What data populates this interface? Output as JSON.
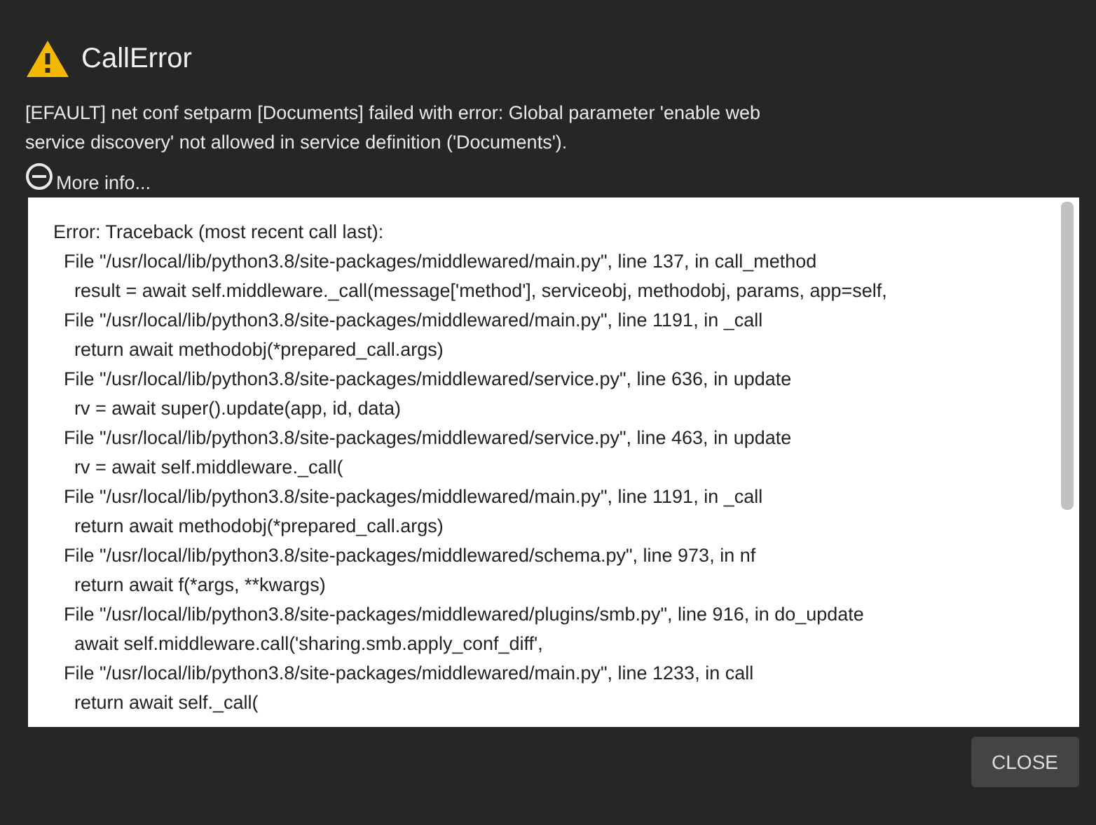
{
  "dialog": {
    "title": "CallError",
    "message": "[EFAULT] net conf setparm [Documents] failed with error: Global parameter 'enable web service discovery' not allowed in service definition ('Documents').",
    "more_info": {
      "label": "More info...",
      "expanded": true
    },
    "traceback": [
      "Error: Traceback (most recent call last):",
      "  File \"/usr/local/lib/python3.8/site-packages/middlewared/main.py\", line 137, in call_method",
      "    result = await self.middleware._call(message['method'], serviceobj, methodobj, params, app=self,",
      "  File \"/usr/local/lib/python3.8/site-packages/middlewared/main.py\", line 1191, in _call",
      "    return await methodobj(*prepared_call.args)",
      "  File \"/usr/local/lib/python3.8/site-packages/middlewared/service.py\", line 636, in update",
      "    rv = await super().update(app, id, data)",
      "  File \"/usr/local/lib/python3.8/site-packages/middlewared/service.py\", line 463, in update",
      "    rv = await self.middleware._call(",
      "  File \"/usr/local/lib/python3.8/site-packages/middlewared/main.py\", line 1191, in _call",
      "    return await methodobj(*prepared_call.args)",
      "  File \"/usr/local/lib/python3.8/site-packages/middlewared/schema.py\", line 973, in nf",
      "    return await f(*args, **kwargs)",
      "  File \"/usr/local/lib/python3.8/site-packages/middlewared/plugins/smb.py\", line 916, in do_update",
      "    await self.middleware.call('sharing.smb.apply_conf_diff',",
      "  File \"/usr/local/lib/python3.8/site-packages/middlewared/main.py\", line 1233, in call",
      "    return await self._call("
    ],
    "buttons": [
      {
        "label": "CLOSE"
      }
    ]
  }
}
